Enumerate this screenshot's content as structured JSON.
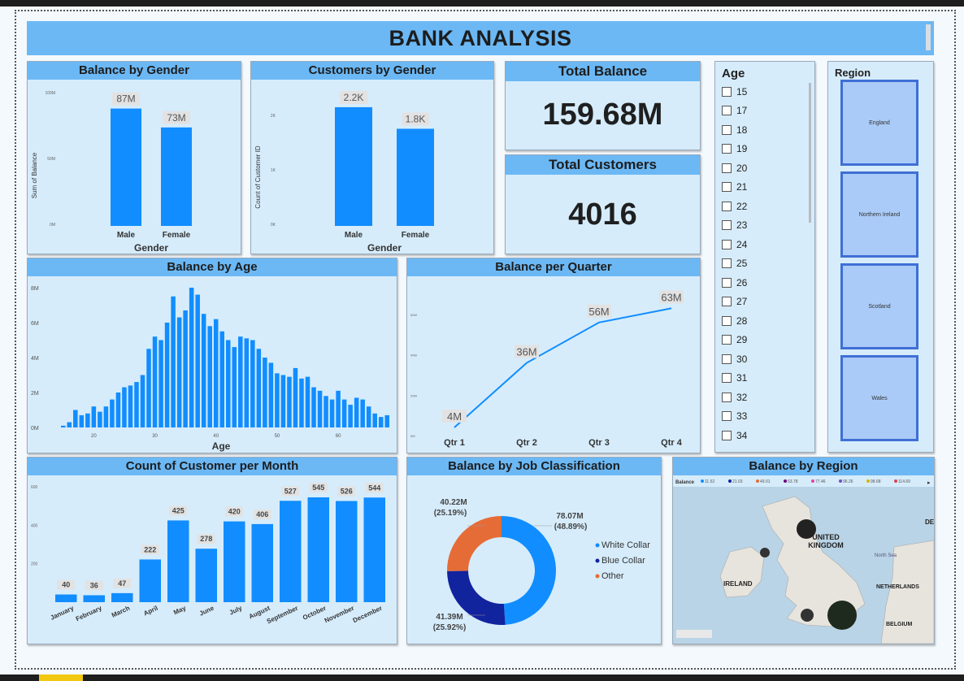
{
  "dashboard": {
    "title": "BANK ANALYSIS"
  },
  "balance_gender": {
    "title": "Balance by Gender",
    "ylabel": "Sum of Balance",
    "xlabel": "Gender",
    "yticks": [
      "100M",
      "50M",
      "0M"
    ],
    "chart_data": {
      "type": "bar",
      "categories": [
        "Male",
        "Female"
      ],
      "values": [
        87,
        73
      ],
      "labels": [
        "87M",
        "73M"
      ],
      "ylim": [
        0,
        100
      ],
      "unit": "M"
    }
  },
  "customers_gender": {
    "title": "Customers by Gender",
    "ylabel": "Count of Customer ID",
    "xlabel": "Gender",
    "yticks": [
      "2K",
      "1K",
      "0K"
    ],
    "chart_data": {
      "type": "bar",
      "categories": [
        "Male",
        "Female"
      ],
      "values": [
        2.2,
        1.8
      ],
      "labels": [
        "2.2K",
        "1.8K"
      ],
      "ylim": [
        0,
        2.5
      ],
      "unit": "K"
    }
  },
  "kpi_balance": {
    "title": "Total Balance",
    "value": "159.68M"
  },
  "kpi_customers": {
    "title": "Total Customers",
    "value": "4016"
  },
  "age_slicer": {
    "title": "Age",
    "items": [
      "15",
      "17",
      "18",
      "19",
      "20",
      "21",
      "22",
      "23",
      "24",
      "25",
      "26",
      "27",
      "28",
      "29",
      "30",
      "31",
      "32",
      "33",
      "34"
    ]
  },
  "region_slicer": {
    "title": "Region",
    "items": [
      "England",
      "Northern Ireland",
      "Scotland",
      "Wales"
    ]
  },
  "balance_age": {
    "title": "Balance by Age",
    "xlabel": "Age",
    "yticks": [
      "8M",
      "6M",
      "4M",
      "2M",
      "0M"
    ],
    "xticks": [
      "20",
      "30",
      "40",
      "50",
      "60"
    ],
    "chart_data": {
      "type": "bar",
      "x_start": 15,
      "ylim": [
        0,
        8
      ],
      "values": [
        0.1,
        0.3,
        1.0,
        0.7,
        0.8,
        1.2,
        0.9,
        1.2,
        1.6,
        2.0,
        2.3,
        2.4,
        2.6,
        3.0,
        4.5,
        5.2,
        5.0,
        6.0,
        7.5,
        6.3,
        6.7,
        8.0,
        7.6,
        6.5,
        5.8,
        6.2,
        5.5,
        5.0,
        4.6,
        5.2,
        5.1,
        5.0,
        4.5,
        4.0,
        3.7,
        3.1,
        3.0,
        2.9,
        3.4,
        2.8,
        2.9,
        2.3,
        2.1,
        1.8,
        1.6,
        2.1,
        1.6,
        1.3,
        1.7,
        1.6,
        1.2,
        0.8,
        0.6,
        0.7
      ]
    }
  },
  "balance_quarter": {
    "title": "Balance per Quarter",
    "yticks": [
      "60M",
      "40M",
      "20M",
      "0M"
    ],
    "chart_data": {
      "type": "line",
      "categories": [
        "Qtr 1",
        "Qtr 2",
        "Qtr 3",
        "Qtr 4"
      ],
      "values": [
        4,
        36,
        56,
        63
      ],
      "labels": [
        "4M",
        "36M",
        "56M",
        "63M"
      ],
      "ylim": [
        0,
        70
      ]
    }
  },
  "customer_month": {
    "title": "Count of Customer per Month",
    "yticks": [
      "600",
      "400",
      "200"
    ],
    "chart_data": {
      "type": "bar",
      "categories": [
        "January",
        "February",
        "March",
        "April",
        "May",
        "June",
        "July",
        "August",
        "September",
        "October",
        "November",
        "December"
      ],
      "values": [
        40,
        36,
        47,
        222,
        425,
        278,
        420,
        406,
        527,
        545,
        526,
        544
      ],
      "ylim": [
        0,
        600
      ]
    }
  },
  "balance_job": {
    "title": "Balance by Job Classification",
    "chart_data": {
      "type": "pie",
      "categories": [
        "White Collar",
        "Blue Collar",
        "Other"
      ],
      "values": [
        78.07,
        41.39,
        40.22
      ],
      "percents": [
        48.89,
        25.92,
        25.19
      ],
      "colors": [
        "#118dff",
        "#12239e",
        "#e66c37"
      ]
    },
    "labels": {
      "white_value": "78.07M",
      "white_pct": "(48.89%)",
      "blue_value": "41.39M",
      "blue_pct": "(25.92%)",
      "other_value": "40.22M",
      "other_pct": "(25.19%)"
    },
    "legend": [
      "White Collar",
      "Blue Collar",
      "Other"
    ]
  },
  "balance_region": {
    "title": "Balance by Region",
    "legend_label": "Balance",
    "legend_values": [
      "11.52",
      "21.03",
      "49.01",
      "63.78",
      "77.46",
      "96.26",
      "98.68",
      "114.69"
    ],
    "legend_colors": [
      "#118dff",
      "#12239e",
      "#e66c37",
      "#6b007b",
      "#e044a7",
      "#744ec2",
      "#d9b300",
      "#d64550"
    ],
    "map_labels": {
      "uk": "UNITED\nKINGDOM",
      "ireland": "IRELAND",
      "netherlands": "NETHERLANDS",
      "belgium": "BELGIUM",
      "north_sea": "North Sea",
      "de": "DE"
    }
  }
}
